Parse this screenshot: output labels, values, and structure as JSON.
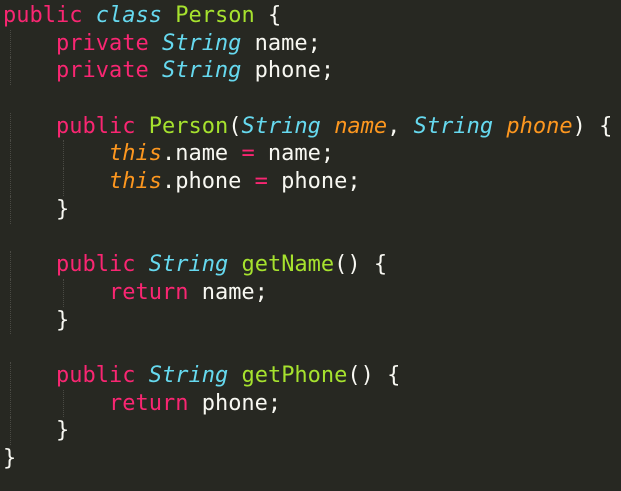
{
  "editor": {
    "colors": {
      "background": "#272822",
      "default": "#f8f8f2",
      "keyword": "#f92672",
      "storage": "#66d9ef",
      "entity": "#a6e22e",
      "parameter": "#fd971f",
      "indent_guide": "#4a4a44"
    },
    "lines": [
      {
        "indent": 0,
        "tokens": [
          {
            "t": "public",
            "c": "keyword"
          },
          {
            "t": " "
          },
          {
            "t": "class",
            "c": "storage",
            "i": true
          },
          {
            "t": " "
          },
          {
            "t": "Person",
            "c": "entity"
          },
          {
            "t": " {"
          }
        ]
      },
      {
        "indent": 1,
        "tokens": [
          {
            "t": "private",
            "c": "keyword"
          },
          {
            "t": " "
          },
          {
            "t": "String",
            "c": "storage",
            "i": true
          },
          {
            "t": " name;"
          }
        ]
      },
      {
        "indent": 1,
        "tokens": [
          {
            "t": "private",
            "c": "keyword"
          },
          {
            "t": " "
          },
          {
            "t": "String",
            "c": "storage",
            "i": true
          },
          {
            "t": " phone;"
          }
        ]
      },
      {
        "indent": 0,
        "tokens": []
      },
      {
        "indent": 1,
        "tokens": [
          {
            "t": "public",
            "c": "keyword"
          },
          {
            "t": " "
          },
          {
            "t": "Person",
            "c": "entity"
          },
          {
            "t": "("
          },
          {
            "t": "String",
            "c": "storage",
            "i": true
          },
          {
            "t": " "
          },
          {
            "t": "name",
            "c": "parameter",
            "i": true
          },
          {
            "t": ", "
          },
          {
            "t": "String",
            "c": "storage",
            "i": true
          },
          {
            "t": " "
          },
          {
            "t": "phone",
            "c": "parameter",
            "i": true
          },
          {
            "t": ") {"
          }
        ]
      },
      {
        "indent": 2,
        "tokens": [
          {
            "t": "this",
            "c": "parameter",
            "i": true
          },
          {
            "t": ".name "
          },
          {
            "t": "=",
            "c": "keyword"
          },
          {
            "t": " name;"
          }
        ]
      },
      {
        "indent": 2,
        "tokens": [
          {
            "t": "this",
            "c": "parameter",
            "i": true
          },
          {
            "t": ".phone "
          },
          {
            "t": "=",
            "c": "keyword"
          },
          {
            "t": " phone;"
          }
        ]
      },
      {
        "indent": 1,
        "tokens": [
          {
            "t": "}"
          }
        ]
      },
      {
        "indent": 0,
        "tokens": []
      },
      {
        "indent": 1,
        "tokens": [
          {
            "t": "public",
            "c": "keyword"
          },
          {
            "t": " "
          },
          {
            "t": "String",
            "c": "storage",
            "i": true
          },
          {
            "t": " "
          },
          {
            "t": "getName",
            "c": "entity"
          },
          {
            "t": "() {"
          }
        ]
      },
      {
        "indent": 2,
        "tokens": [
          {
            "t": "return",
            "c": "keyword"
          },
          {
            "t": " name;"
          }
        ]
      },
      {
        "indent": 1,
        "tokens": [
          {
            "t": "}"
          }
        ]
      },
      {
        "indent": 0,
        "tokens": []
      },
      {
        "indent": 1,
        "tokens": [
          {
            "t": "public",
            "c": "keyword"
          },
          {
            "t": " "
          },
          {
            "t": "String",
            "c": "storage",
            "i": true
          },
          {
            "t": " "
          },
          {
            "t": "getPhone",
            "c": "entity"
          },
          {
            "t": "() {"
          }
        ]
      },
      {
        "indent": 2,
        "tokens": [
          {
            "t": "return",
            "c": "keyword"
          },
          {
            "t": " phone;"
          }
        ]
      },
      {
        "indent": 1,
        "tokens": [
          {
            "t": "}"
          }
        ]
      },
      {
        "indent": 0,
        "tokens": [
          {
            "t": "}"
          }
        ]
      }
    ]
  }
}
